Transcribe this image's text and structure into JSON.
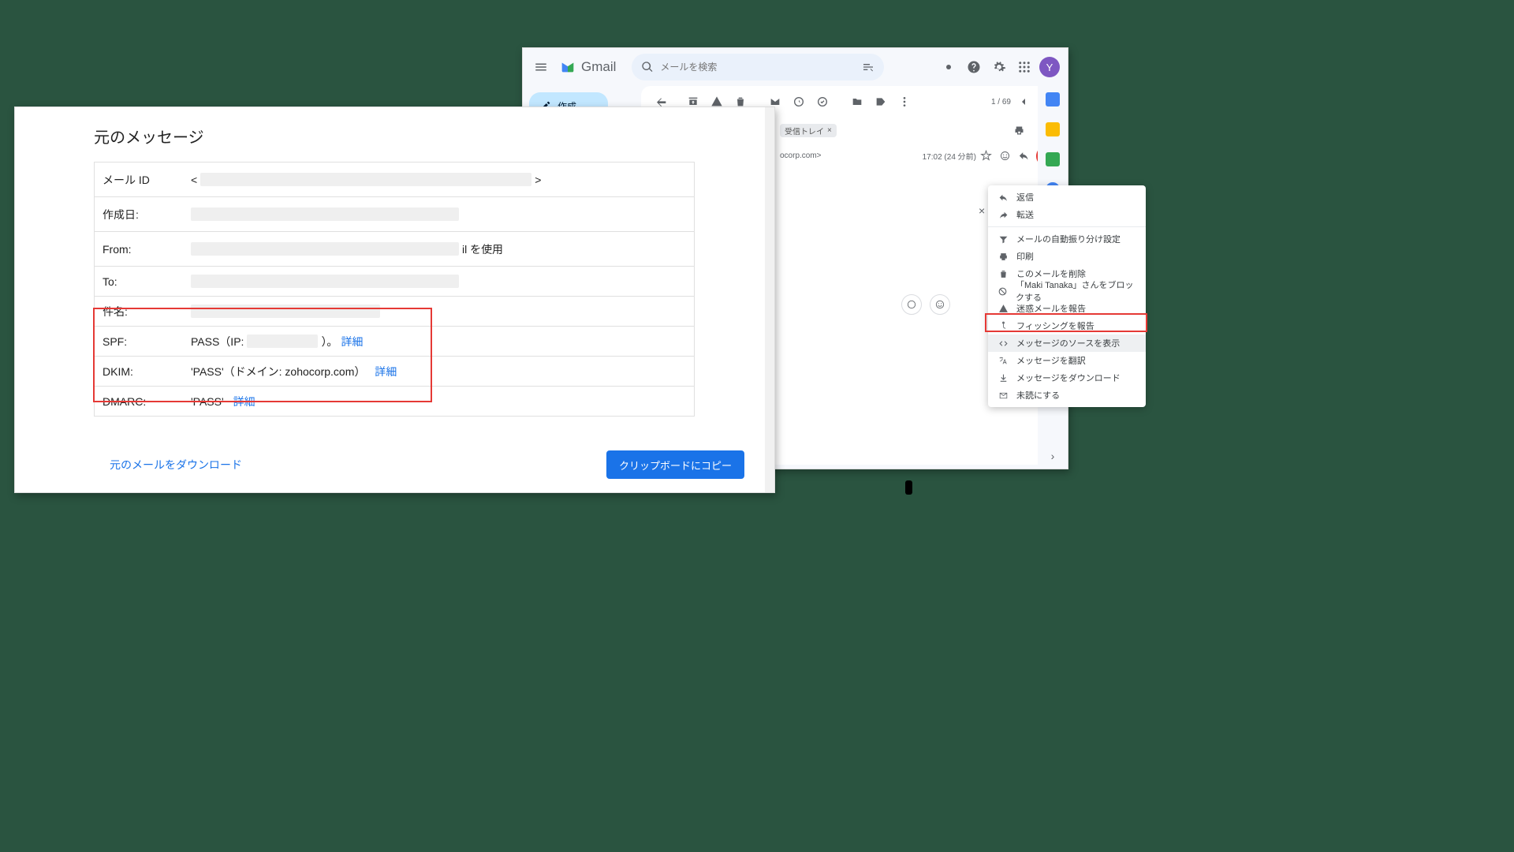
{
  "gmail": {
    "product": "Gmail",
    "search_placeholder": "メールを検索",
    "compose": "作成",
    "count": "1 / 69",
    "avatar": "Y",
    "chip_label": "受信トレイ",
    "sender_domain": "ocorp.com>",
    "time": "17:02 (24 分前)",
    "ctx": {
      "reply": "返信",
      "forward": "転送",
      "filter": "メールの自動振り分け設定",
      "print": "印刷",
      "delete": "このメールを削除",
      "block": "「Maki Tanaka」さんをブロックする",
      "spam": "迷惑メールを報告",
      "phishing": "フィッシングを報告",
      "source": "メッセージのソースを表示",
      "translate": "メッセージを翻訳",
      "download": "メッセージをダウンロード",
      "unread": "未読にする"
    }
  },
  "orig": {
    "title": "元のメッセージ",
    "rows": {
      "mail_id": "メール ID",
      "created": "作成日:",
      "from": "From:",
      "from_suffix": "il を使用",
      "to": "To:",
      "subject": "件名:",
      "spf": "SPF:",
      "spf_val1": "PASS（IP: ",
      "spf_val2": "）。",
      "dkim": "DKIM:",
      "dkim_val": "'PASS'（ドメイン: zohocorp.com）",
      "dmarc": "DMARC:",
      "dmarc_val": "'PASS'",
      "detail": "詳細"
    },
    "download": "元のメールをダウンロード",
    "copy": "クリップボードにコピー"
  }
}
